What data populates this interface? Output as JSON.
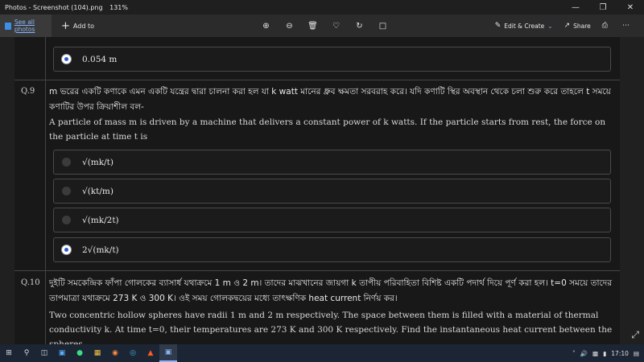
{
  "window": {
    "title": "Photos - Screenshot (104).png",
    "zoom": "131%"
  },
  "toolbar": {
    "see_all": "See all photos",
    "add_to": "Add to",
    "edit_create": "Edit & Create",
    "share": "Share"
  },
  "questions": {
    "prev_selected_option": "0.054 m",
    "q9": {
      "number": "Q.9",
      "bengali": "m ভরের একটি কণাকে এমন একটি যন্ত্রের দ্বারা চালনা করা হল যা k watt মানের ধ্রুব ক্ষমতা সরবরাহ করে। যদি কণাটি স্থির অবস্থান থেকে চলা শুরু করে তাহলে t সময়ে কণাটির উপর ক্রিয়াশীল বল-",
      "english": "A particle of mass m is driven by a machine that delivers a constant power of k watts. If the particle starts from rest, the force on the particle at time t is",
      "options": [
        "√(mk/t)",
        "√(kt/m)",
        "√(mk/2t)",
        "2√(mk/t)"
      ],
      "selected_index": 3
    },
    "q10": {
      "number": "Q.10",
      "bengali": "দুইটি সমকেন্দ্রিক ফাঁপা গোলকের ব্যাসার্ধ যথাক্রমে 1 m ও 2 m। তাদের মাঝখানের জায়গা k তাপীয় পরিবাহিতা বিশিষ্ট একটি পদার্থ দিয়ে পূর্ণ করা হল। t=0 সময়ে তাদের তাপমাত্রা যথাক্রমে 273 K ও 300 K। ওই সময় গোলকদ্বয়ের মধ্যে তাৎক্ষণিক heat current নির্ণয় কর।",
      "english": "Two concentric hollow spheres have radii 1 m and 2 m respectively. The space between them is filled with a material of thermal conductivity k. At time t=0, their temperatures are 273 K and 300 K respectively. Find the instantaneous heat current between the spheres."
    }
  },
  "taskbar": {
    "time": "17:10"
  }
}
